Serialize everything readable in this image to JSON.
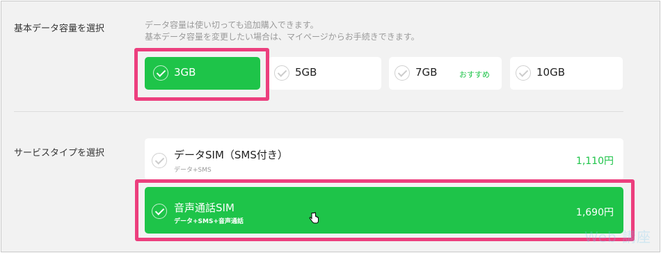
{
  "data_capacity": {
    "label": "基本データ容量を選択",
    "notes": [
      "データ容量は使い切っても追加購入できます。",
      "基本データ容量を変更したい場合は、マイページからお手続きできます。"
    ],
    "options": [
      {
        "label": "3GB",
        "selected": true
      },
      {
        "label": "5GB",
        "selected": false
      },
      {
        "label": "7GB",
        "badge": "おすすめ",
        "selected": false
      },
      {
        "label": "10GB",
        "selected": false
      }
    ]
  },
  "service_type": {
    "label": "サービスタイプを選択",
    "options": [
      {
        "title": "データSIM（SMS付き）",
        "sub": "データ+SMS",
        "price": "1,110円",
        "selected": false
      },
      {
        "title": "音声通話SIM",
        "sub": "データ+SMS+音声通話",
        "price": "1,690円",
        "selected": true
      }
    ]
  },
  "watermark": "Web 講座",
  "colors": {
    "accent": "#1ec449",
    "highlight": "#ec3f7e",
    "background": "#f2f2f2"
  }
}
